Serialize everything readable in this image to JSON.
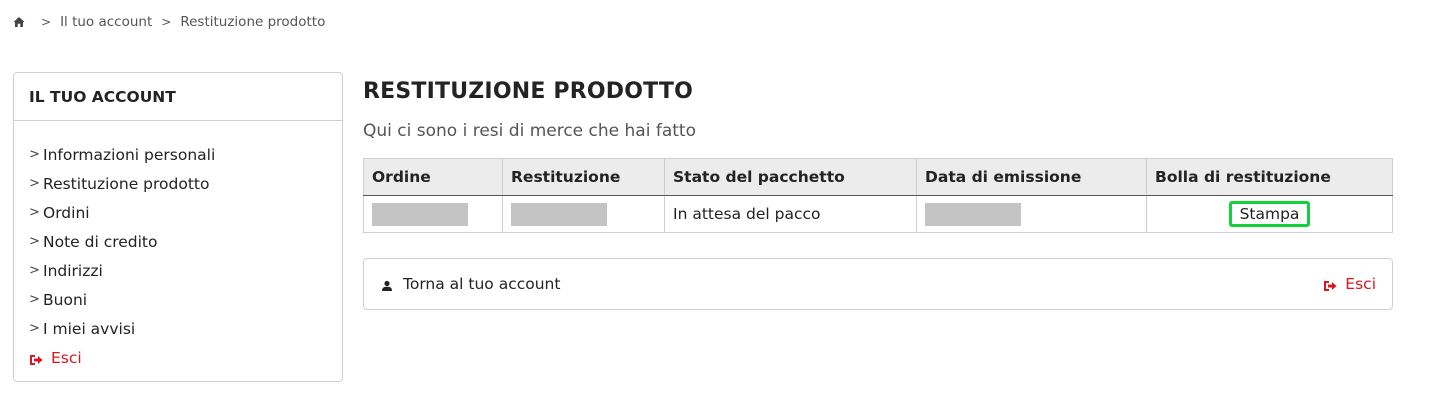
{
  "breadcrumb": {
    "home_icon": "home-icon",
    "items": [
      "Il tuo account",
      "Restituzione prodotto"
    ]
  },
  "sidebar": {
    "title": "IL TUO ACCOUNT",
    "items": [
      {
        "label": "Informazioni personali"
      },
      {
        "label": "Restituzione prodotto"
      },
      {
        "label": "Ordini"
      },
      {
        "label": "Note di credito"
      },
      {
        "label": "Indirizzi"
      },
      {
        "label": "Buoni"
      },
      {
        "label": "I miei avvisi"
      }
    ],
    "logout_label": "Esci"
  },
  "main": {
    "title": "RESTITUZIONE PRODOTTO",
    "subtitle": "Qui ci sono i resi di merce che hai fatto",
    "table": {
      "headers": [
        "Ordine",
        "Restituzione",
        "Stato del pacchetto",
        "Data di emissione",
        "Bolla di restituzione"
      ],
      "rows": [
        {
          "status": "In attesa del pacco",
          "action": "Stampa"
        }
      ]
    },
    "footer": {
      "back_label": "Torna al tuo account",
      "logout_label": "Esci"
    }
  },
  "colors": {
    "accent_red": "#d8171e",
    "highlight_green": "#12d13a"
  }
}
